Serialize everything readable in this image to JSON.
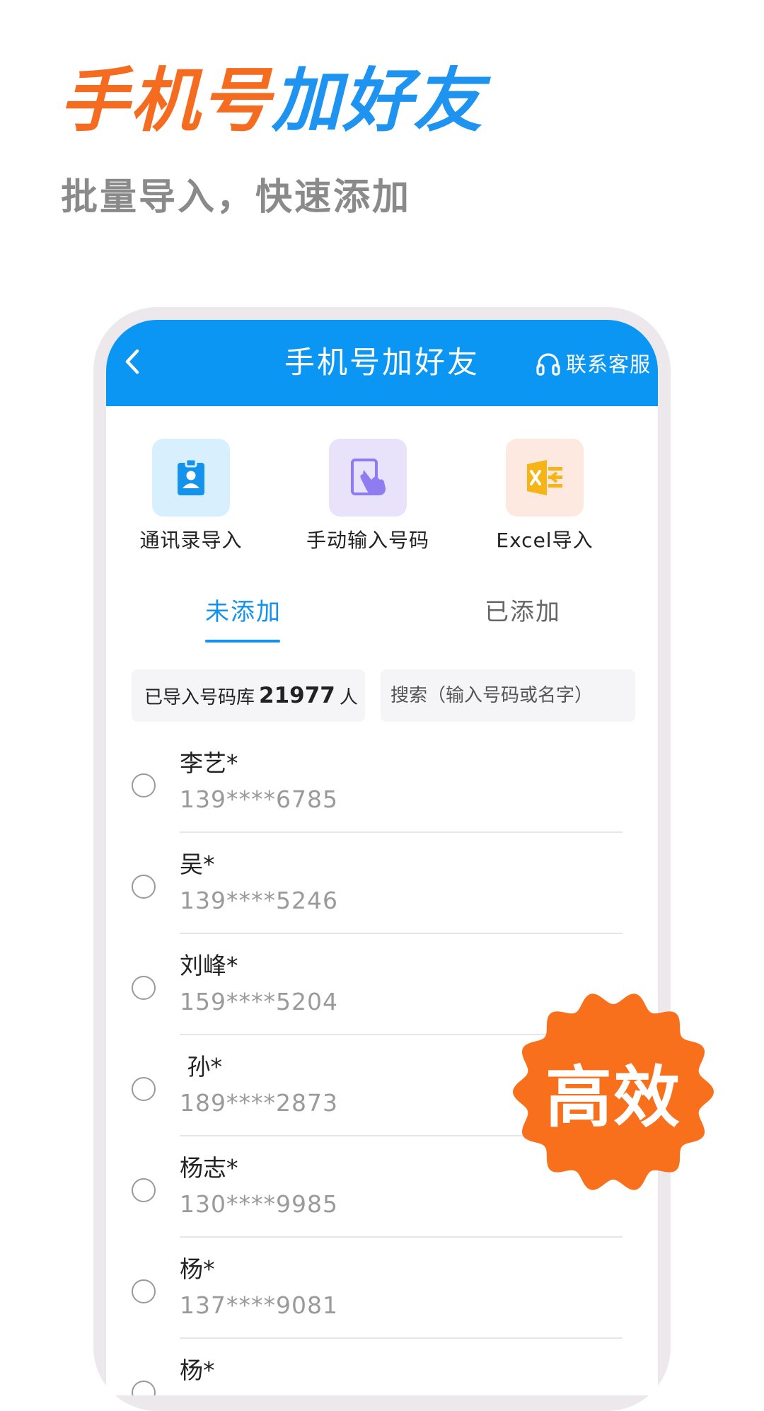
{
  "hero": {
    "title_orange": "手机号",
    "title_blue": "加好友",
    "subtitle": "批量导入，快速添加"
  },
  "navbar": {
    "back_icon": "chevron-left-icon",
    "title": "手机号加好友",
    "support_icon": "headset-icon",
    "support_label": "联系客服"
  },
  "actions": [
    {
      "label": "通讯录导入",
      "icon": "contact-card-icon"
    },
    {
      "label": "手动输入号码",
      "icon": "hand-tap-icon"
    },
    {
      "label": "Excel导入",
      "icon": "excel-import-icon"
    }
  ],
  "tabs": {
    "active": "未添加",
    "inactive": "已添加"
  },
  "import_count": {
    "prefix": "已导入号码库",
    "count": "21977",
    "suffix": "人"
  },
  "search": {
    "placeholder": "搜索（输入号码或名字）"
  },
  "contacts": [
    {
      "name": "李艺*",
      "phone": "139****6785"
    },
    {
      "name": "吴*",
      "phone": "139****5246"
    },
    {
      "name": "刘峰*",
      "phone": "159****5204"
    },
    {
      "name": " 孙*",
      "phone": "189****2873"
    },
    {
      "name": "杨志*",
      "phone": "130****9985"
    },
    {
      "name": "杨*",
      "phone": "137****9081"
    },
    {
      "name": "杨*",
      "phone": ""
    }
  ],
  "badge": {
    "label": "高效"
  },
  "colors": {
    "brand_blue": "#0a96f2",
    "accent_orange": "#f56b1f",
    "tab_active": "#1592eb"
  }
}
